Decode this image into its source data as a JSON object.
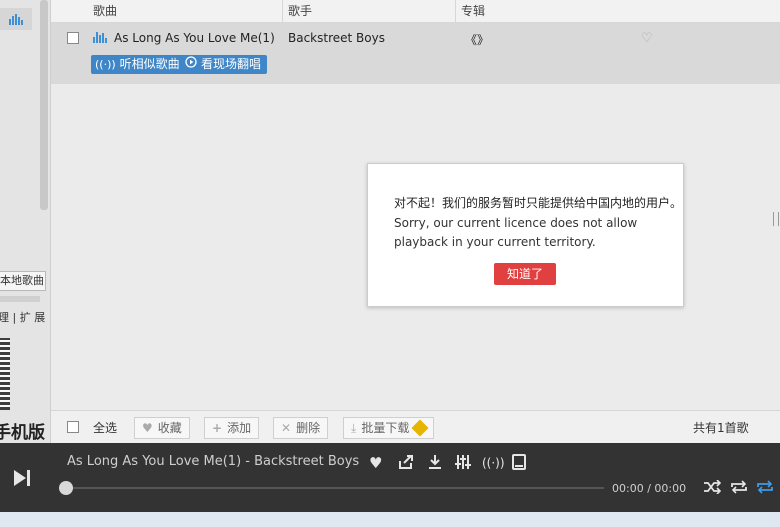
{
  "columns": {
    "song": "歌曲",
    "artist": "歌手",
    "album": "专辑"
  },
  "track": {
    "title": "As Long As You Love Me(1)",
    "artist": "Backstreet Boys",
    "album": "《》",
    "similar_label": "听相似歌曲",
    "live_label": "看现场翻唱"
  },
  "left_panel": {
    "local_songs": "本地歌曲",
    "tools": "理 | 扩 展",
    "mobile_version": "手机版"
  },
  "dialog": {
    "message_cn": "对不起！我们的服务暂时只能提供给中国内地的用户。",
    "message_en": "Sorry, our current licence does not allow playback in your current territory.",
    "ok_label": "知道了"
  },
  "toolbar": {
    "select_all": "全选",
    "favorite": "收藏",
    "add": "添加",
    "delete": "删除",
    "batch_download": "批量下载",
    "total": "共有1首歌"
  },
  "player": {
    "now_playing": "As Long As You Love Me(1)  -  Backstreet Boys",
    "time": "00:00 / 00:00",
    "progress": 0
  },
  "colors": {
    "accent_blue": "#3e86c7",
    "ok_red": "#e0403f",
    "player_bg": "#333333"
  }
}
